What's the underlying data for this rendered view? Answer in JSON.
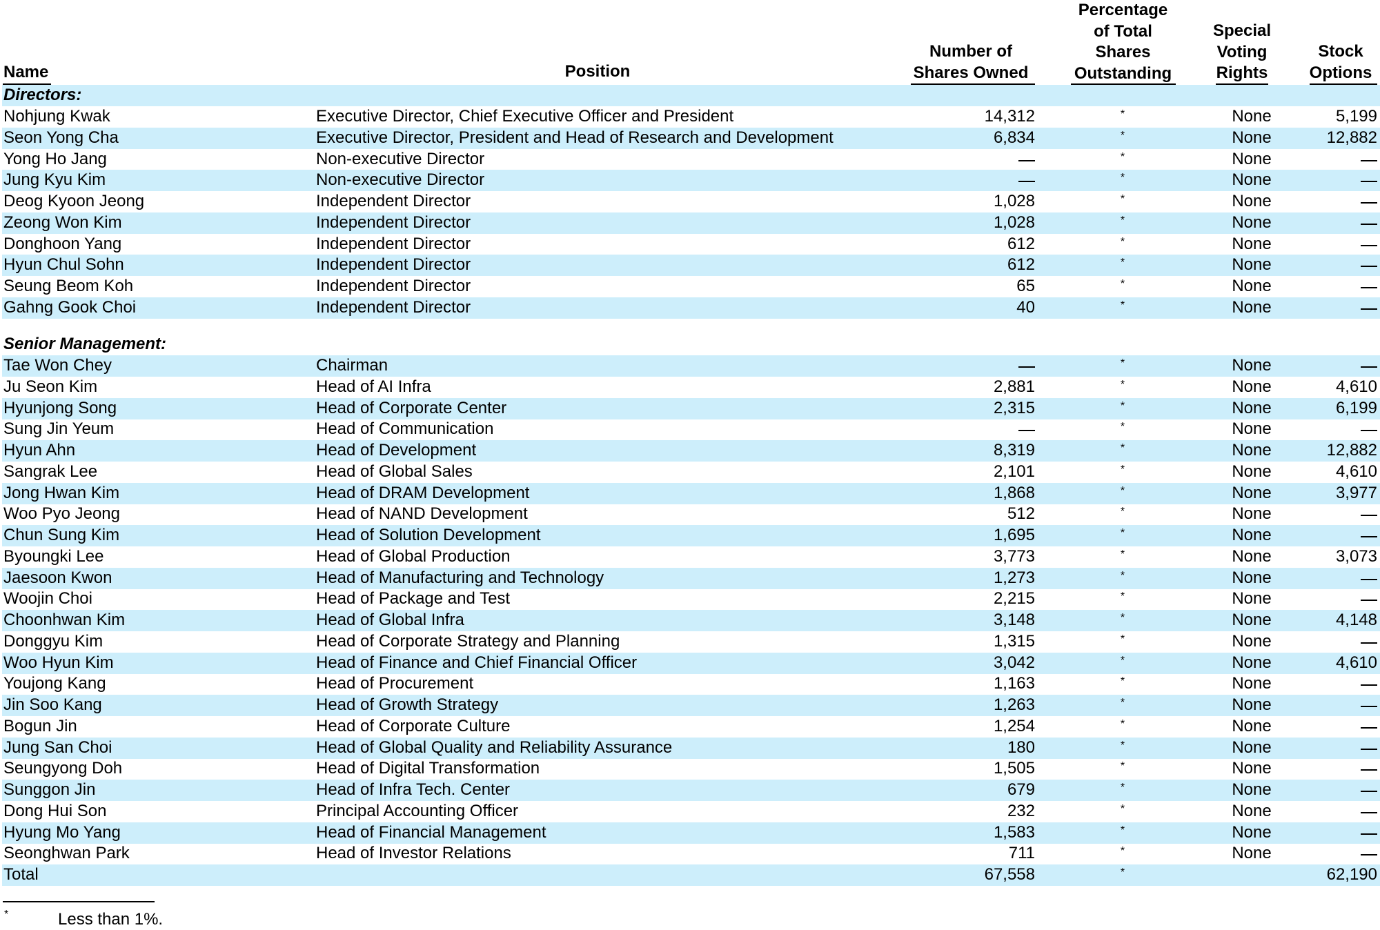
{
  "headers": {
    "name": "Name",
    "position": "Position",
    "shares": [
      "Number of",
      "Shares Owned"
    ],
    "percentage": [
      "Percentage",
      "of Total",
      "Shares",
      "Outstanding"
    ],
    "voting": [
      "Special",
      "Voting",
      "Rights"
    ],
    "options": [
      "Stock",
      "Options"
    ]
  },
  "sections": {
    "directors": "Directors:",
    "senior_management": "Senior Management:"
  },
  "directors": [
    {
      "name": "Nohjung Kwak",
      "position": "Executive Director, Chief Executive Officer and President",
      "shares": "14,312",
      "pct": "*",
      "voting": "None",
      "options": "5,199"
    },
    {
      "name": "Seon Yong Cha",
      "position": "Executive Director, President and Head of Research and Development",
      "shares": "6,834",
      "pct": "*",
      "voting": "None",
      "options": "12,882"
    },
    {
      "name": "Yong Ho Jang",
      "position": "Non-executive Director",
      "shares": "—",
      "pct": "*",
      "voting": "None",
      "options": "—"
    },
    {
      "name": "Jung Kyu Kim",
      "position": "Non-executive Director",
      "shares": "—",
      "pct": "*",
      "voting": "None",
      "options": "—"
    },
    {
      "name": "Deog Kyoon Jeong",
      "position": "Independent Director",
      "shares": "1,028",
      "pct": "*",
      "voting": "None",
      "options": "—"
    },
    {
      "name": "Zeong Won Kim",
      "position": "Independent Director",
      "shares": "1,028",
      "pct": "*",
      "voting": "None",
      "options": "—"
    },
    {
      "name": "Donghoon Yang",
      "position": "Independent Director",
      "shares": "612",
      "pct": "*",
      "voting": "None",
      "options": "—"
    },
    {
      "name": "Hyun Chul Sohn",
      "position": "Independent Director",
      "shares": "612",
      "pct": "*",
      "voting": "None",
      "options": "—"
    },
    {
      "name": "Seung Beom Koh",
      "position": "Independent Director",
      "shares": "65",
      "pct": "*",
      "voting": "None",
      "options": "—"
    },
    {
      "name": "Gahng Gook Choi",
      "position": "Independent Director",
      "shares": "40",
      "pct": "*",
      "voting": "None",
      "options": "—"
    }
  ],
  "senior_management": [
    {
      "name": "Tae Won Chey",
      "position": "Chairman",
      "shares": "—",
      "pct": "*",
      "voting": "None",
      "options": "—"
    },
    {
      "name": "Ju Seon Kim",
      "position": "Head of AI Infra",
      "shares": "2,881",
      "pct": "*",
      "voting": "None",
      "options": "4,610"
    },
    {
      "name": "Hyunjong Song",
      "position": "Head of Corporate Center",
      "shares": "2,315",
      "pct": "*",
      "voting": "None",
      "options": "6,199"
    },
    {
      "name": "Sung Jin Yeum",
      "position": "Head of Communication",
      "shares": "—",
      "pct": "*",
      "voting": "None",
      "options": "—"
    },
    {
      "name": "Hyun Ahn",
      "position": "Head of Development",
      "shares": "8,319",
      "pct": "*",
      "voting": "None",
      "options": "12,882"
    },
    {
      "name": "Sangrak Lee",
      "position": "Head of Global Sales",
      "shares": "2,101",
      "pct": "*",
      "voting": "None",
      "options": "4,610"
    },
    {
      "name": "Jong Hwan Kim",
      "position": "Head of DRAM Development",
      "shares": "1,868",
      "pct": "*",
      "voting": "None",
      "options": "3,977"
    },
    {
      "name": "Woo Pyo Jeong",
      "position": "Head of NAND Development",
      "shares": "512",
      "pct": "*",
      "voting": "None",
      "options": "—"
    },
    {
      "name": "Chun Sung Kim",
      "position": "Head of Solution Development",
      "shares": "1,695",
      "pct": "*",
      "voting": "None",
      "options": "—"
    },
    {
      "name": "Byoungki Lee",
      "position": "Head of Global Production",
      "shares": "3,773",
      "pct": "*",
      "voting": "None",
      "options": "3,073"
    },
    {
      "name": "Jaesoon Kwon",
      "position": "Head of Manufacturing and Technology",
      "shares": "1,273",
      "pct": "*",
      "voting": "None",
      "options": "—"
    },
    {
      "name": "Woojin Choi",
      "position": "Head of Package and Test",
      "shares": "2,215",
      "pct": "*",
      "voting": "None",
      "options": "—"
    },
    {
      "name": "Choonhwan Kim",
      "position": "Head of Global Infra",
      "shares": "3,148",
      "pct": "*",
      "voting": "None",
      "options": "4,148"
    },
    {
      "name": "Donggyu Kim",
      "position": "Head of Corporate Strategy and Planning",
      "shares": "1,315",
      "pct": "*",
      "voting": "None",
      "options": "—"
    },
    {
      "name": "Woo Hyun Kim",
      "position": "Head of Finance and Chief Financial Officer",
      "shares": "3,042",
      "pct": "*",
      "voting": "None",
      "options": "4,610"
    },
    {
      "name": "Youjong Kang",
      "position": "Head of Procurement",
      "shares": "1,163",
      "pct": "*",
      "voting": "None",
      "options": "—"
    },
    {
      "name": "Jin Soo Kang",
      "position": "Head of Growth Strategy",
      "shares": "1,263",
      "pct": "*",
      "voting": "None",
      "options": "—"
    },
    {
      "name": "Bogun Jin",
      "position": "Head of Corporate Culture",
      "shares": "1,254",
      "pct": "*",
      "voting": "None",
      "options": "—"
    },
    {
      "name": "Jung San Choi",
      "position": "Head of Global Quality and Reliability Assurance",
      "shares": "180",
      "pct": "*",
      "voting": "None",
      "options": "—"
    },
    {
      "name": "Seungyong Doh",
      "position": "Head of Digital Transformation",
      "shares": "1,505",
      "pct": "*",
      "voting": "None",
      "options": "—"
    },
    {
      "name": "Sunggon Jin",
      "position": "Head of Infra Tech. Center",
      "shares": "679",
      "pct": "*",
      "voting": "None",
      "options": "—"
    },
    {
      "name": "Dong Hui Son",
      "position": "Principal Accounting Officer",
      "shares": "232",
      "pct": "*",
      "voting": "None",
      "options": "—"
    },
    {
      "name": "Hyung Mo Yang",
      "position": "Head of Financial Management",
      "shares": "1,583",
      "pct": "*",
      "voting": "None",
      "options": "—"
    },
    {
      "name": "Seonghwan Park",
      "position": "Head of Investor Relations",
      "shares": "711",
      "pct": "*",
      "voting": "None",
      "options": "—"
    }
  ],
  "total": {
    "name": "Total",
    "shares": "67,558",
    "pct": "*",
    "options": "62,190"
  },
  "footnote": {
    "mark": "*",
    "text": "Less than 1%."
  }
}
